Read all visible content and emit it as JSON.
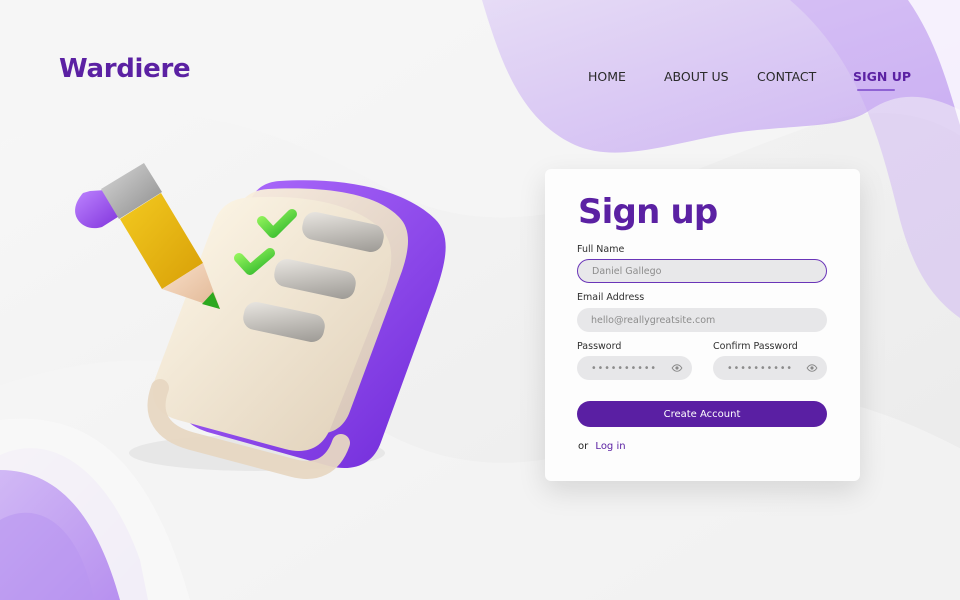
{
  "brand": {
    "name": "Wardiere"
  },
  "nav": {
    "items": [
      {
        "label": "HOME",
        "active": false
      },
      {
        "label": "ABOUT US",
        "active": false
      },
      {
        "label": "CONTACT",
        "active": false
      },
      {
        "label": "SIGN UP",
        "active": true
      }
    ]
  },
  "hero": {
    "icon": "checklist-pencil-illustration"
  },
  "signup": {
    "title": "Sign up",
    "fields": {
      "full_name": {
        "label": "Full Name",
        "value": "Daniel Gallego"
      },
      "email": {
        "label": "Email Address",
        "placeholder": "hello@reallygreatsite.com"
      },
      "password": {
        "label": "Password",
        "value": "••••••••••"
      },
      "confirm_password": {
        "label": "Confirm Password",
        "value": "••••••••••"
      }
    },
    "create_button": "Create Account",
    "login_prefix": "or",
    "login_link": "Log in"
  },
  "colors": {
    "brand": "#5b21a3",
    "button": "#5a1fa3",
    "accent_light": "#b995f2",
    "accent_medium": "#9f6ce8",
    "background": "#efefef"
  },
  "icons": {
    "password_toggle": "eye-icon"
  }
}
